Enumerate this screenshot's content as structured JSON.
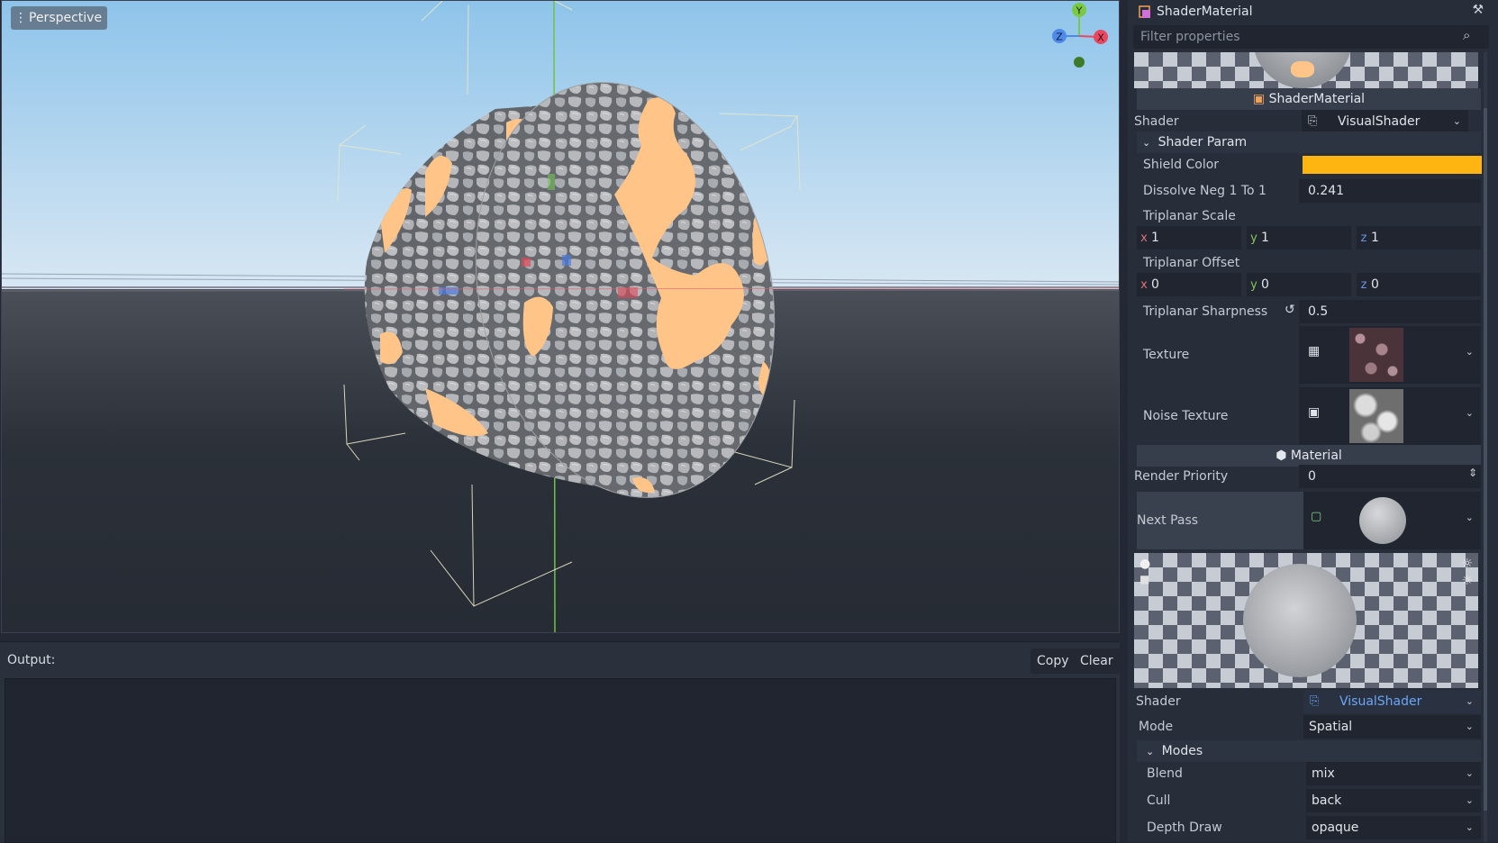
{
  "viewport": {
    "perspective_label": "Perspective",
    "gizmo": {
      "y": "Y",
      "x": "X",
      "z": "Z"
    }
  },
  "output": {
    "label": "Output:",
    "copy_label": "Copy",
    "clear_label": "Clear"
  },
  "inspector": {
    "title": "ShaderMaterial",
    "filter_placeholder": "Filter properties",
    "shader_material_header": "ShaderMaterial",
    "shader_label": "Shader",
    "shader_value": "VisualShader",
    "shader_param_section": "Shader Param",
    "shield_color_label": "Shield Color",
    "shield_color": "#ffb511",
    "dissolve_label": "Dissolve Neg 1 To 1",
    "dissolve_value": "0.241",
    "triplanar_scale_label": "Triplanar Scale",
    "triplanar_scale": {
      "x": "1",
      "y": "1",
      "z": "1"
    },
    "triplanar_offset_label": "Triplanar Offset",
    "triplanar_offset": {
      "x": "0",
      "y": "0",
      "z": "0"
    },
    "axis_x": "x",
    "axis_y": "y",
    "axis_z": "z",
    "triplanar_sharpness_label": "Triplanar Sharpness",
    "triplanar_sharpness_value": "0.5",
    "texture_label": "Texture",
    "noise_texture_label": "Noise Texture",
    "material_header": "Material",
    "render_priority_label": "Render Priority",
    "render_priority_value": "0",
    "next_pass_label": "Next Pass",
    "sub_shader_label": "Shader",
    "sub_shader_value": "VisualShader",
    "mode_label": "Mode",
    "mode_value": "Spatial",
    "modes_section": "Modes",
    "blend_label": "Blend",
    "blend_value": "mix",
    "cull_label": "Cull",
    "cull_value": "back",
    "depth_draw_label": "Depth Draw",
    "depth_draw_value": "opaque"
  },
  "colors": {
    "sky_top": "#8fc6ea",
    "sky_horizon": "#d6e6f2",
    "ground": "#262b34",
    "lava": "#ffc488",
    "link_blue": "#6aa6f8"
  }
}
